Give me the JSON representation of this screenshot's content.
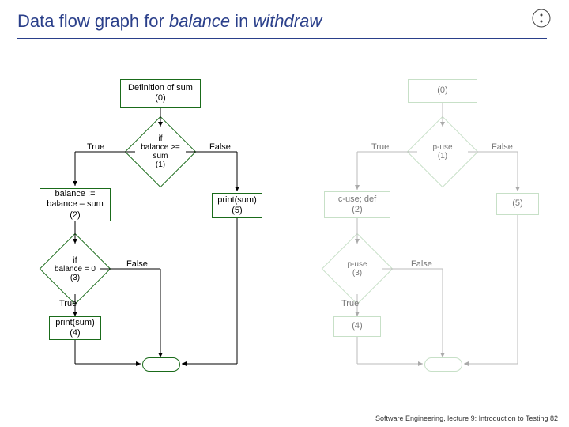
{
  "title": {
    "part1": "Data flow graph for ",
    "part2": "balance",
    "part3": " in ",
    "part4": "withdraw"
  },
  "left": {
    "node0": "Definition of sum\n(0)",
    "decision1": "if\nbalance >=\nsum\n(1)",
    "true1": "True",
    "false1": "False",
    "node2": "balance :=\nbalance – sum\n(2)",
    "node5": "print(sum)\n(5)",
    "decision3": "if\nbalance = 0\n(3)",
    "false3": "False",
    "true3": "True",
    "node4": "print(sum)\n(4)"
  },
  "right": {
    "node0": "(0)",
    "decision1": "p-use\n(1)",
    "true1": "True",
    "false1": "False",
    "node2": "c-use; def\n(2)",
    "node5": "(5)",
    "decision3": "p-use\n(3)",
    "false3": "False",
    "true3": "True",
    "node4": "(4)"
  },
  "footer": "Software Engineering, lecture 9: Introduction to Testing   82"
}
